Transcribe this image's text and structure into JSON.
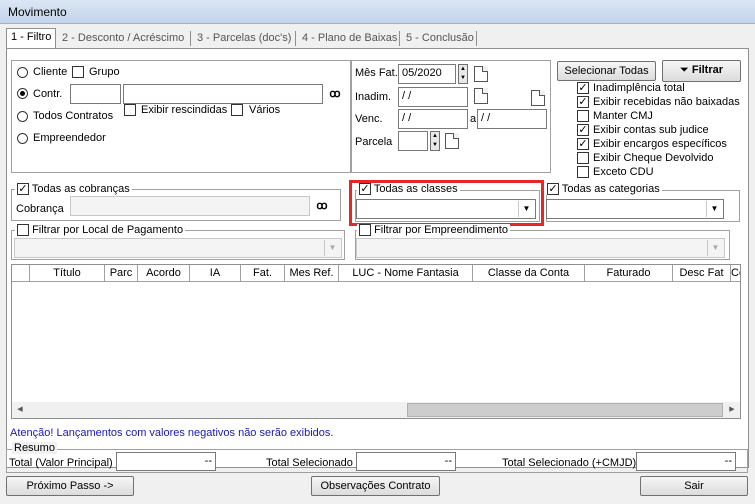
{
  "window": {
    "title": "Movimento"
  },
  "tabs": [
    "1 - Filtro",
    "2 - Desconto / Acréscimo",
    "3 - Parcelas (doc's)",
    "4 - Plano de Baixas",
    "5 - Conclusão"
  ],
  "left_group": {
    "cliente_label": "Cliente",
    "grupo_label": "Grupo",
    "contr_label": "Contr.",
    "todos_contratos_label": "Todos Contratos",
    "empreendedor_label": "Empreendedor",
    "exibir_rescindidas_label": "Exibir rescindidas",
    "varios_label": "Vários",
    "contr_code_value": "",
    "contr_name_value": ""
  },
  "dates": {
    "mes_fat_label": "Mês Fat.",
    "mes_fat_value": "05/2020",
    "inadim_label": "Inadim.",
    "inadim_value": " / /",
    "venc_label": "Venc.",
    "venc_from": " / /",
    "venc_sep": "a",
    "venc_to": " / /",
    "parcela_label": "Parcela",
    "parcela_value": ""
  },
  "actions": {
    "selecionar_todas": "Selecionar Todas",
    "filtrar": "Filtrar"
  },
  "options": [
    {
      "label": "Inadimplência total",
      "checked": true
    },
    {
      "label": "Exibir recebidas não baixadas",
      "checked": true
    },
    {
      "label": "Manter CMJ",
      "checked": false
    },
    {
      "label": "Exibir contas sub judice",
      "checked": true
    },
    {
      "label": "Exibir encargos específicos",
      "checked": true
    },
    {
      "label": "Exibir Cheque Devolvido",
      "checked": false
    },
    {
      "label": "Exceto CDU",
      "checked": false
    }
  ],
  "filters": {
    "todas_cobrancas_label": "Todas as cobranças",
    "cobranca_label": "Cobrança",
    "todas_classes_label": "Todas as classes",
    "todas_categorias_label": "Todas as categorias",
    "local_pagamento_label": "Filtrar por Local de Pagamento",
    "empreendimento_label": "Filtrar por Empreendimento"
  },
  "grid": {
    "columns": [
      "Título",
      "Parc",
      "Acordo",
      "IA",
      "Fat.",
      "Mes Ref.",
      "LUC - Nome Fantasia",
      "Classe da Conta",
      "Faturado",
      "Desc Fat",
      "Co"
    ]
  },
  "warning": "Atenção! Lançamentos com valores negativos não serão exibidos.",
  "resumo": {
    "title": "Resumo",
    "total_principal_label": "Total (Valor Principal)",
    "total_principal_value": "--",
    "total_selecionado_label": "Total Selecionado",
    "total_selecionado_value": "--",
    "total_selecionado_cmjd_label": "Total Selecionado (+CMJD)",
    "total_selecionado_cmjd_value": "--"
  },
  "footer": {
    "proximo": "Próximo Passo ->",
    "observacoes": "Observações Contrato",
    "sair": "Sair"
  },
  "colors": {
    "highlight": "#e8262a",
    "title_gradient_top": "#dbe6f4",
    "warning_text": "#1a1ab0"
  }
}
